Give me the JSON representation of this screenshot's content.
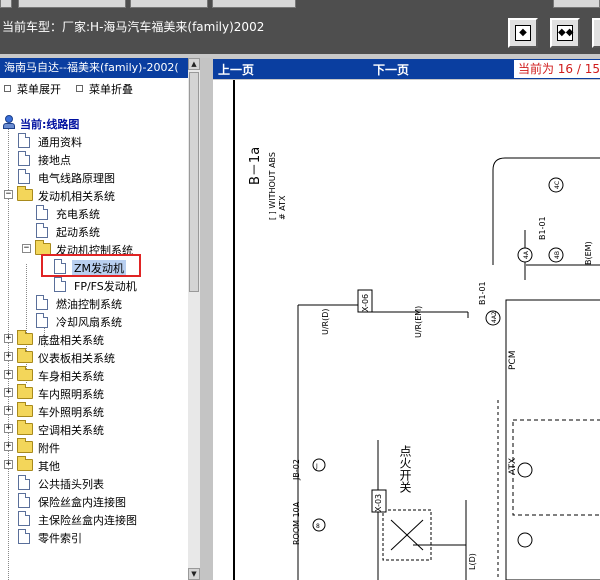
{
  "header": {
    "car_label": "当前车型：厂家:H-海马汽车福美来(family)2002",
    "btn1_icon": "collapse-left-icon",
    "btn2_icon": "collapse-both-icon",
    "btn3_icon": "window-icon"
  },
  "left": {
    "title": "海南马自达--福美来(family)-2002(",
    "expand_label": "菜单展开",
    "collapse_label": "菜单折叠"
  },
  "tree": {
    "root": "当前:线路图",
    "items": [
      "通用资料",
      "接地点",
      "电气线路原理图",
      "发动机相关系统",
      "充电系统",
      "起动系统",
      "发动机控制系统",
      "ZM发动机",
      "FP/FS发动机",
      "燃油控制系统",
      "冷却风扇系统",
      "底盘相关系统",
      "仪表板相关系统",
      "车身相关系统",
      "车内照明系统",
      "车外照明系统",
      "空调相关系统",
      "附件",
      "其他",
      "公共插头列表",
      "保险丝盒内连接图",
      "主保险丝盒内连接图",
      "零件索引"
    ]
  },
  "nav": {
    "prev": "上一页",
    "next": "下一页",
    "page_indicator": "当前为 16 / 15"
  },
  "diagram": {
    "page_id": "B－1a",
    "note_line1": "[ ] WITHOUT ABS",
    "note_line2": "# ATX",
    "wire_ur_d": "U/R(D)",
    "wire_ur_em": "U/R(EM)",
    "conn_x06": "X-06",
    "conn_x03": "X-03",
    "pin_4a": "4A",
    "pin_4a2": "4A2",
    "pin_4b": "4B",
    "pin_4c": "4C",
    "b1_01_a": "B1-01",
    "b1_01_b": "B1-01",
    "b_em": "B(EM)",
    "pcm": "PCM",
    "atx": "ATX",
    "jb_02": "JB-02",
    "room": "ROOM 10A",
    "ignition": "点火开关",
    "l_d": "L(D)",
    "circle_j": "J",
    "circle_8": "8"
  }
}
